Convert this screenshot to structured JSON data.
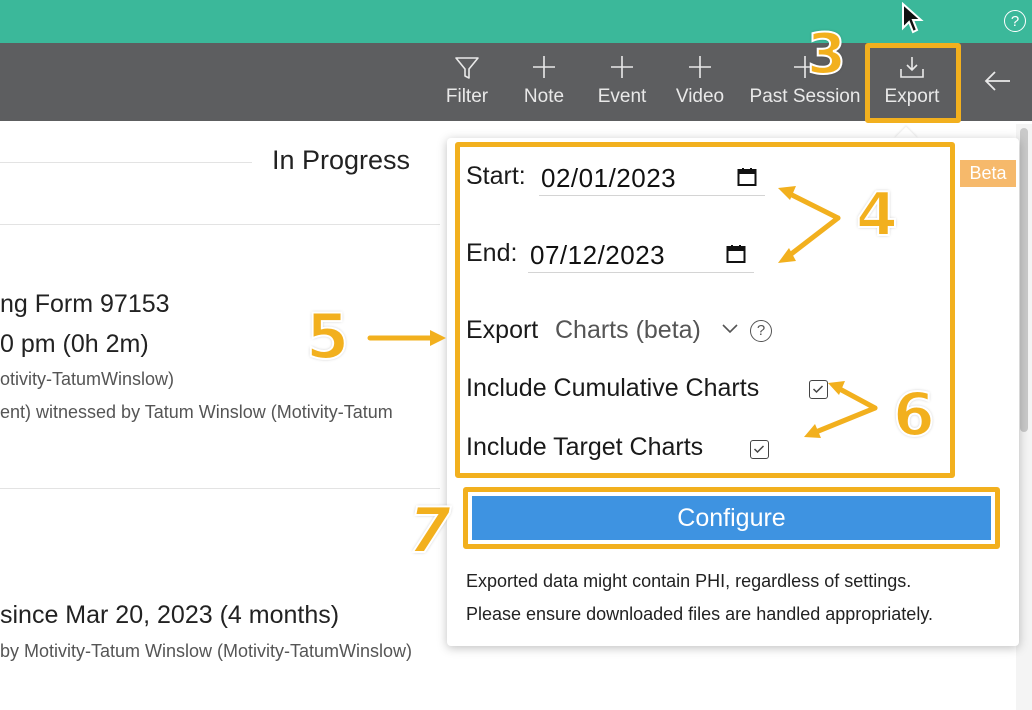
{
  "header": {
    "help_icon": "help-circle-icon"
  },
  "toolbar": {
    "items": [
      {
        "label": "Filter",
        "icon": "filter-icon"
      },
      {
        "label": "Note",
        "icon": "plus-icon"
      },
      {
        "label": "Event",
        "icon": "plus-icon"
      },
      {
        "label": "Video",
        "icon": "plus-icon"
      },
      {
        "label": "Past Session",
        "icon": "plus-icon"
      },
      {
        "label": "Export",
        "icon": "download-icon"
      }
    ],
    "back_icon": "arrow-left-icon"
  },
  "background": {
    "status_heading": "In Progress",
    "item1": {
      "title": "ng Form 97153",
      "time": "0 pm (0h 2m)",
      "user": "otivity-TatumWinslow)",
      "witness": "ent) witnessed by Tatum Winslow (Motivity-Tatum"
    },
    "item2": {
      "since": "since Mar 20, 2023 (4 months)",
      "by": "by Motivity-Tatum Winslow (Motivity-TatumWinslow)"
    }
  },
  "export_panel": {
    "beta_badge": "Beta",
    "start_label": "Start:",
    "start_value": "02/01/2023",
    "end_label": "End:",
    "end_value": "07/12/2023",
    "export_label": "Export",
    "export_selected": "Charts (beta)",
    "include_cumulative_label": "Include Cumulative Charts",
    "include_cumulative_checked": true,
    "include_target_label": "Include Target Charts",
    "include_target_checked": true,
    "configure_button": "Configure",
    "note_line1": "Exported data might contain PHI, regardless of settings.",
    "note_line2": "Please ensure downloaded files are handled appropriately."
  },
  "annotations": {
    "step3": "3",
    "step4": "4",
    "step5": "5",
    "step6": "6",
    "step7": "7",
    "highlight_color": "#f2b01e"
  }
}
